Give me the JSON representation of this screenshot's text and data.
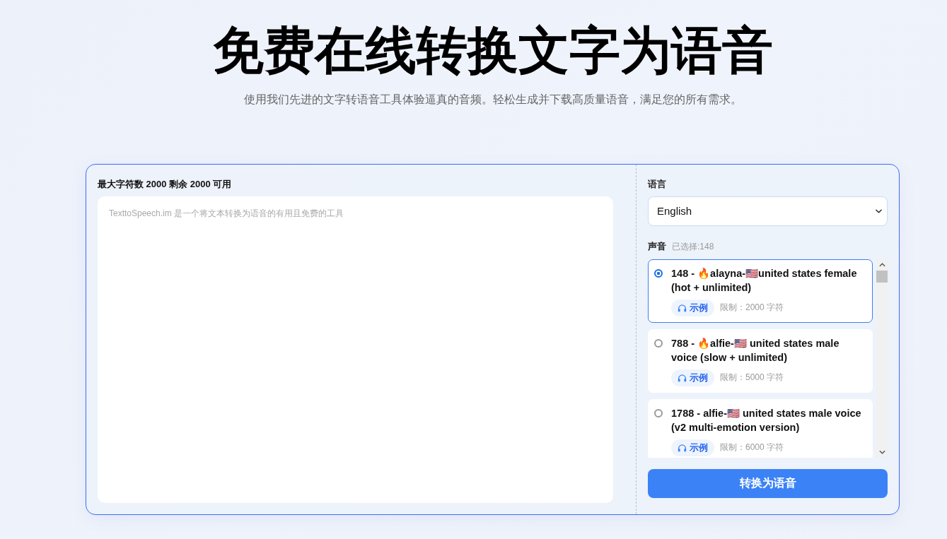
{
  "hero": {
    "title": "免费在线转换文字为语音",
    "subtitle": "使用我们先进的文字转语音工具体验逼真的音频。轻松生成并下载高质量语音，满足您的所有需求。"
  },
  "editor": {
    "counter": "最大字符数 2000 剩余 2000 可用",
    "placeholder": "TexttoSpeech.im 是一个将文本转换为语音的有用且免费的工具"
  },
  "language": {
    "label": "语言",
    "value": "English"
  },
  "voices": {
    "label": "声音",
    "selected_note": "已选择:148",
    "items": [
      {
        "title": "148 - 🔥alayna-🇺🇸united states female (hot + unlimited)",
        "sample": "示例",
        "limit": "限制：2000 字符",
        "selected": true
      },
      {
        "title": "788 - 🔥alfie-🇺🇸 united states male voice (slow + unlimited)",
        "sample": "示例",
        "limit": "限制：5000 字符",
        "selected": false
      },
      {
        "title": "1788 - alfie-🇺🇸 united states male voice (v2 multi-emotion version)",
        "sample": "示例",
        "limit": "限制：6000 字符",
        "selected": false
      }
    ]
  },
  "convert_button": "转换为语音"
}
